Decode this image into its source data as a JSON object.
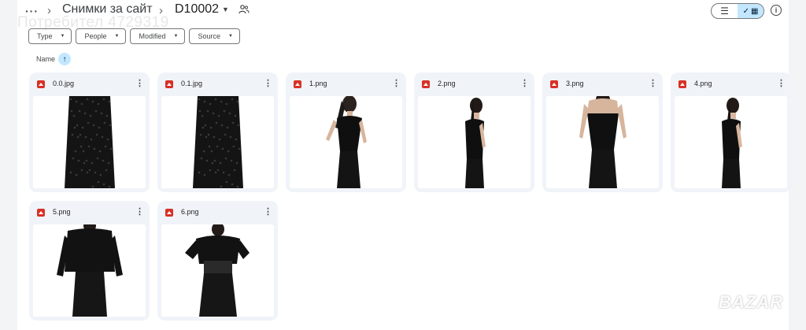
{
  "breadcrumb": {
    "more": "···",
    "parent": "Снимки за сайт",
    "current": "D10002"
  },
  "watermark": "Потребител 4729319",
  "view": {
    "mode": "grid"
  },
  "filters": [
    "Type",
    "People",
    "Modified",
    "Source"
  ],
  "sort": {
    "label": "Name",
    "direction": "ascending"
  },
  "files": [
    {
      "name": "0.0.jpg",
      "thumb": "skirt"
    },
    {
      "name": "0.1.jpg",
      "thumb": "skirt"
    },
    {
      "name": "1.png",
      "thumb": "corset-front"
    },
    {
      "name": "2.png",
      "thumb": "corset-side"
    },
    {
      "name": "3.png",
      "thumb": "corset-back"
    },
    {
      "name": "4.png",
      "thumb": "corset-side"
    },
    {
      "name": "5.png",
      "thumb": "jacket-back"
    },
    {
      "name": "6.png",
      "thumb": "jacket-front"
    }
  ],
  "brand_logo": "BAZAR",
  "colors": {
    "accent": "#c2e7ff",
    "card_bg": "#f0f4f9",
    "image_icon": "#d93025"
  }
}
